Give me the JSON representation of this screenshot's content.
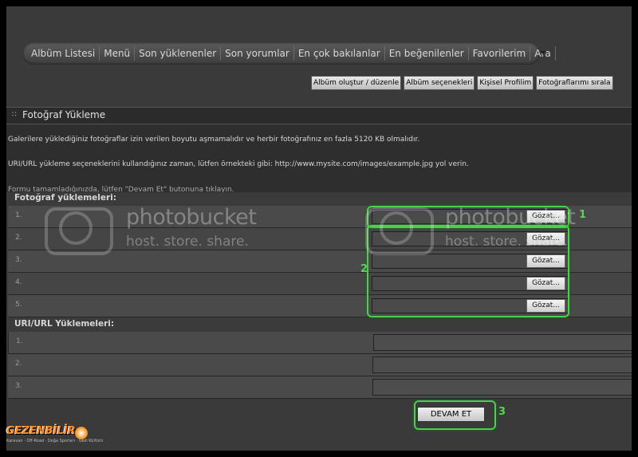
{
  "nav": {
    "items": [
      "Albüm Listesi",
      "Menü",
      "Son yüklenenler",
      "Son yorumlar",
      "En çok bakılanlar",
      "En beğenilenler",
      "Favorilerim",
      "Ara"
    ]
  },
  "subnav": {
    "items": [
      "Albüm oluştur / düzenle",
      "Albüm seçenekleri",
      "Kişisel Profilim",
      "Fotoğraflarımı sırala"
    ]
  },
  "section": {
    "title": "Fotoğraf Yükleme"
  },
  "info": {
    "line1": "Galerilere yüklediğiniz fotoğraflar izin verilen boyutu aşmamalıdır ve herbir fotoğrafınız en fazla 5120 KB olmalıdır.",
    "line2": "URI/URL yükleme seçeneklerini kullandığınız zaman, lütfen örnekteki gibi: http://www.mysite.com/images/example.jpg yol verin.",
    "line3": "Formu tamamladığınızda, lütfen \"Devam Et\" butonuna tıklayın."
  },
  "photo_uploads": {
    "heading": "Fotoğraf yüklemeleri:",
    "rows": [
      "1.",
      "2.",
      "3.",
      "4.",
      "5."
    ],
    "browse_label": "Gözat..."
  },
  "url_uploads": {
    "heading": "URI/URL Yüklemeleri:",
    "rows": [
      "1.",
      "2.",
      "3."
    ]
  },
  "submit_label": "DEVAM ET",
  "annotations": {
    "a1": "1",
    "a2": "2",
    "a3": "3"
  },
  "watermark": {
    "brand": "photobucket",
    "tagline": "host. store. share."
  },
  "logo": {
    "name": "GEZENBİLİR",
    "tagline": "Karavan · Off-Road · Doğa Sporları · Gezi Kültürü"
  },
  "colors": {
    "accent_ring": "#4ad04a",
    "logo_orange": "#ff8a1a"
  }
}
